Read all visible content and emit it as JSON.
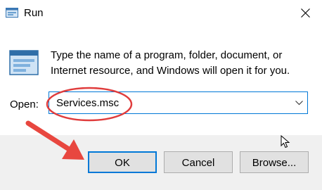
{
  "window": {
    "title": "Run",
    "icon": "run-icon",
    "close_icon": "close-icon"
  },
  "main": {
    "description": "Type the name of a program, folder, document, or Internet resource, and Windows will open it for you.",
    "open_label": "Open:",
    "open_value": "Services.msc",
    "dropdown_icon": "chevron-down-icon"
  },
  "buttons": {
    "ok": "OK",
    "cancel": "Cancel",
    "browse": "Browse..."
  },
  "annotations": {
    "highlight_color": "#e03c3c",
    "arrow_color": "#e8473f"
  },
  "colors": {
    "focus_border": "#0078d7",
    "footer_bg": "#f0f0f0"
  }
}
